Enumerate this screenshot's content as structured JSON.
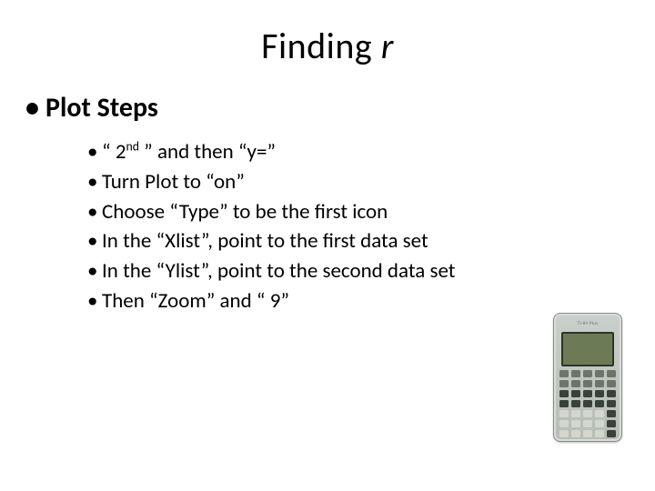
{
  "title_pre": "Finding ",
  "title_ital": "r",
  "section": "Plot Steps",
  "steps": [
    "“ 2nd ” and then “y=”",
    "Turn Plot to “on”",
    "Choose “Type” to be the first icon",
    "In the “Xlist”, point to the first data set",
    "In the “Ylist”, point to the second data set",
    "Then “Zoom” and “ 9”"
  ],
  "calc_label": "TI-84 Plus"
}
